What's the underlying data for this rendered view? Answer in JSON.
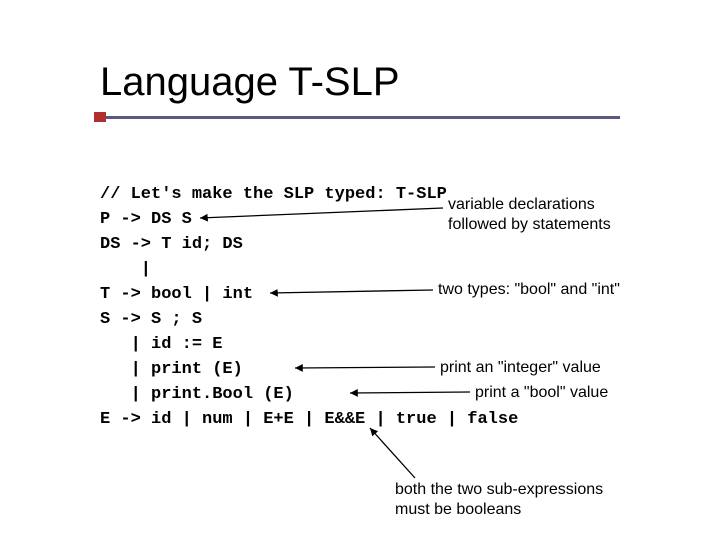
{
  "title": "Language T-SLP",
  "code": {
    "l1": "// Let's make the SLP typed: T-SLP",
    "l2": "P -> DS S",
    "l3": "DS -> T id; DS",
    "l4": "    |",
    "l5": "T -> bool | int",
    "l6": "S -> S ; S",
    "l7": "   | id := E",
    "l8": "   | print (E)",
    "l9": "   | print.Bool (E)",
    "l10": "E -> id | num | E+E | E&&E | true | false"
  },
  "ann": {
    "a1_l1": "variable declarations",
    "a1_l2": "followed by statements",
    "a2": "two types: \"bool\" and \"int\"",
    "a3": "print an \"integer\" value",
    "a4": "print a \"bool\" value",
    "a5_l1": "both the two sub-expressions",
    "a5_l2": "must be booleans"
  }
}
